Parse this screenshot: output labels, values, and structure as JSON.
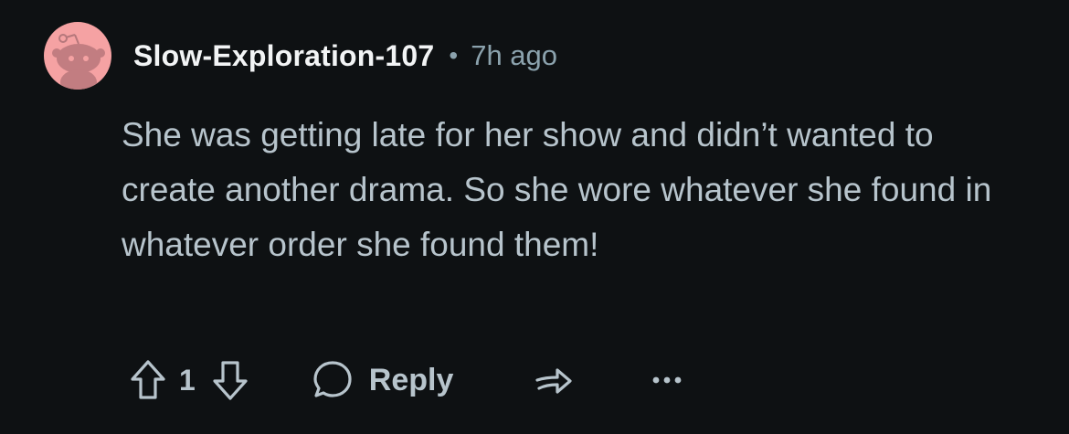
{
  "comment": {
    "avatar": {
      "icon": "snoo-avatar-icon",
      "bg_color": "#f5a2a3"
    },
    "username": "Slow-Exploration-107",
    "separator": "•",
    "timestamp": "7h ago",
    "text": "She was getting late for her show and didn’t wanted to create another drama. So she wore whatever she found in whatever order she found them!",
    "actions": {
      "upvote_icon": "arrow-up-icon",
      "vote_count": "1",
      "downvote_icon": "arrow-down-icon",
      "reply_icon": "speech-bubble-icon",
      "reply_label": "Reply",
      "share_icon": "share-icon",
      "more_icon": "ellipsis-icon"
    }
  },
  "colors": {
    "background": "#0e1113",
    "username": "#f2f4f5",
    "meta": "#8ba2ad",
    "text": "#b7c4cc"
  }
}
